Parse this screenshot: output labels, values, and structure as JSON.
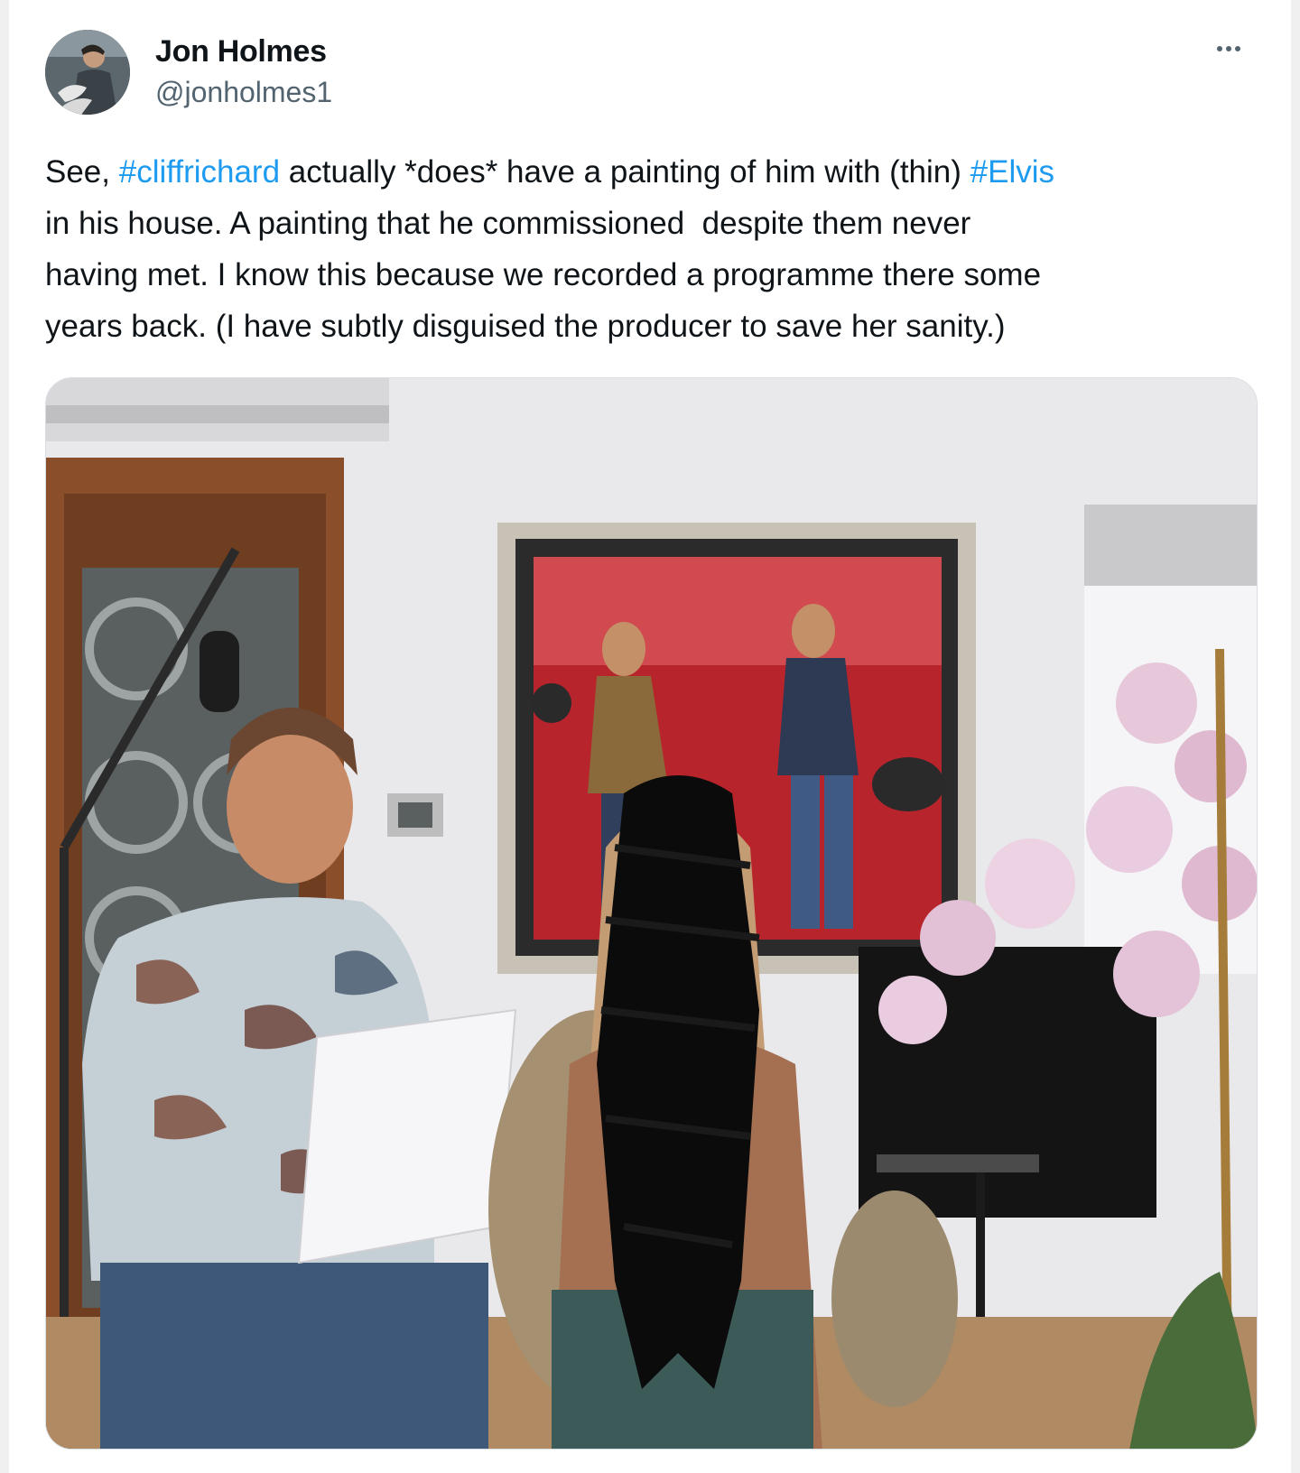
{
  "author": {
    "name": "Jon Holmes",
    "handle": "@jonholmes1"
  },
  "menu": {
    "icon": "more-horizontal-icon"
  },
  "tweet": {
    "lines": [
      [
        {
          "text": "See, ",
          "type": "text"
        },
        {
          "text": "#cliffrichard",
          "type": "hashtag"
        },
        {
          "text": " actually *does* have a painting of him with (thin) ",
          "type": "text"
        },
        {
          "text": "#Elvis",
          "type": "hashtag"
        }
      ],
      [
        {
          "text": "in his house. A painting that he commissioned  despite them never",
          "type": "text"
        }
      ],
      [
        {
          "text": "having met. I know this because we recorded a programme there some",
          "type": "text"
        }
      ],
      [
        {
          "text": "years back. (I have subtly disguised the producer to save her sanity.)",
          "type": "text"
        }
      ]
    ]
  },
  "colors": {
    "hashtag": "#1d9bf0",
    "text": "#0f1419",
    "secondary": "#536471"
  }
}
